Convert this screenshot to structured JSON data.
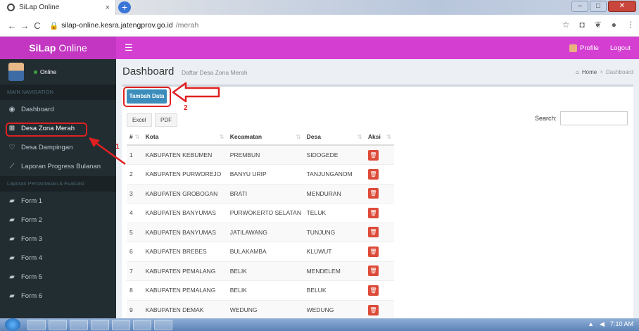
{
  "browser": {
    "tab_title": "SiLap Online",
    "tab_close": "×",
    "new_tab": "+",
    "win_buttons": [
      "–",
      "□",
      "✕"
    ],
    "url_host": "silap-online.kesra.jatengprov.go.id",
    "url_path": "/merah"
  },
  "header": {
    "brand_bold": "SiLap",
    "brand_thin": "Online",
    "menu_icon": "☰",
    "profile": "Profile",
    "logout": "Logout"
  },
  "sidebar": {
    "user_status": "Online",
    "section_main": "MAIN NAVIGATION",
    "items": [
      {
        "label": "Dashboard",
        "icon": "dashboard-icon"
      },
      {
        "label": "Desa Zona Merah",
        "icon": "square-plus-icon"
      },
      {
        "label": "Desa Dampingan",
        "icon": "heart-icon"
      },
      {
        "label": "Laporan Progress Bulanan",
        "icon": "line-chart-icon"
      }
    ],
    "section_eval": "Laporan Pemantauan & Evaluasi",
    "forms": [
      "Form 1",
      "Form 2",
      "Form 3",
      "Form 4",
      "Form 5",
      "Form 6"
    ]
  },
  "page": {
    "title": "Dashboard",
    "subtitle": "Daftar Desa Zona Merah",
    "breadcrumb_home": "Home",
    "breadcrumb_sep": ">",
    "breadcrumb_current": "Dashboard"
  },
  "toolbar": {
    "add_label": "Tambah Data",
    "excel_label": "Excel",
    "pdf_label": "PDF",
    "search_label": "Search:"
  },
  "table": {
    "columns": [
      "#",
      "Kota",
      "Kecamatan",
      "Desa",
      "Aksi"
    ],
    "rows": [
      [
        "1",
        "KABUPATEN KEBUMEN",
        "PREMBUN",
        "SIDOGEDE"
      ],
      [
        "2",
        "KABUPATEN PURWOREJO",
        "BANYU URIP",
        "TANJUNGANOM"
      ],
      [
        "3",
        "KABUPATEN GROBOGAN",
        "BRATI",
        "MENDURAN"
      ],
      [
        "4",
        "KABUPATEN BANYUMAS",
        "PURWOKERTO SELATAN",
        "TELUK"
      ],
      [
        "5",
        "KABUPATEN BANYUMAS",
        "JATILAWANG",
        "TUNJUNG"
      ],
      [
        "6",
        "KABUPATEN BREBES",
        "BULAKAMBA",
        "KLUWUT"
      ],
      [
        "7",
        "KABUPATEN PEMALANG",
        "BELIK",
        "MENDELEM"
      ],
      [
        "8",
        "KABUPATEN PEMALANG",
        "BELIK",
        "BELUK"
      ],
      [
        "9",
        "KABUPATEN DEMAK",
        "WEDUNG",
        "WEDUNG"
      ]
    ]
  },
  "annotations": {
    "step1": "1",
    "step2": "2"
  },
  "taskbar": {
    "clock": "7:10 AM"
  },
  "colors": {
    "header": "#d43fd2",
    "brand": "#c236c1",
    "sidebar": "#222d32",
    "primary_button": "#3c8dbc",
    "delete_button": "#dd4b39",
    "annotation": "#e02020"
  }
}
